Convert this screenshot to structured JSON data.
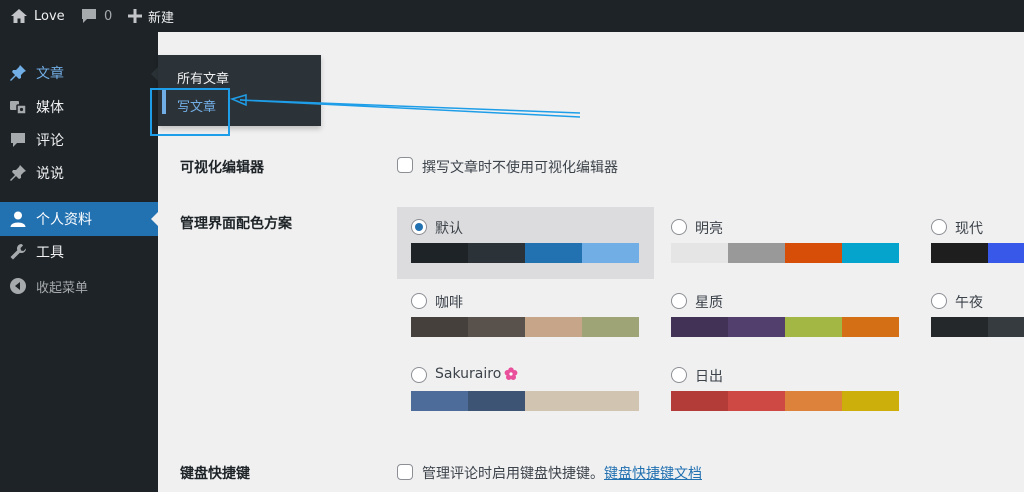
{
  "adminbar": {
    "site_name": "Love",
    "comments_count": "0",
    "new_label": "新建"
  },
  "sidebar": {
    "items": [
      {
        "label": "文章",
        "icon": "pin-icon"
      },
      {
        "label": "媒体",
        "icon": "media-icon"
      },
      {
        "label": "评论",
        "icon": "comment-icon"
      },
      {
        "label": "说说",
        "icon": "pin-icon"
      },
      {
        "label": "个人资料",
        "icon": "user-icon"
      },
      {
        "label": "工具",
        "icon": "wrench-icon"
      },
      {
        "label": "收起菜单",
        "icon": "collapse-icon"
      }
    ]
  },
  "flyout": {
    "all_posts": "所有文章",
    "write_post": "写文章"
  },
  "settings": {
    "editor_label": "可视化编辑器",
    "editor_checkbox_text": "撰写文章时不使用可视化编辑器",
    "scheme_label": "管理界面配色方案",
    "keyboard_label": "键盘快捷键",
    "keyboard_checkbox_text": "管理评论时启用键盘快捷键。",
    "keyboard_doc_link": "键盘快捷键文档"
  },
  "color_schemes": [
    {
      "name": "默认",
      "selected": true,
      "colors": [
        "#1d2327",
        "#2c3338",
        "#2271b1",
        "#72aee6"
      ]
    },
    {
      "name": "明亮",
      "selected": false,
      "colors": [
        "#e5e5e5",
        "#999999",
        "#d64e07",
        "#04a4cc"
      ]
    },
    {
      "name": "现代",
      "selected": false,
      "colors": [
        "#1e1e1e",
        "#1e1e1e",
        "#3858e9",
        "#33f078"
      ]
    },
    {
      "name": "咖啡",
      "selected": false,
      "colors": [
        "#46403c",
        "#59524c",
        "#c7a589",
        "#9ea476"
      ]
    },
    {
      "name": "星质",
      "selected": false,
      "colors": [
        "#413256",
        "#523f6d",
        "#a3b745",
        "#d46f15"
      ]
    },
    {
      "name": "午夜",
      "selected": false,
      "colors": [
        "#25282b",
        "#363b3f",
        "#69a8bb",
        "#e14d43"
      ]
    },
    {
      "name": "Sakurairo",
      "selected": false,
      "colors": [
        "#4e6c99",
        "#3e5475",
        "#d1c4b0",
        "#d1c4b0"
      ]
    },
    {
      "name": "日出",
      "selected": false,
      "colors": [
        "#b43c38",
        "#cf4944",
        "#dd823b",
        "#ccaf0b"
      ]
    }
  ],
  "colors": {
    "accent": "#2271b1",
    "sidebar_bg": "#1d2327",
    "annotation": "#1e9ee8",
    "flower": "#e94f9b"
  }
}
